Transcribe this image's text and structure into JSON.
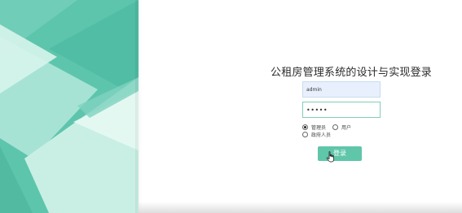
{
  "login": {
    "title": "公租房管理系统的设计与实现登录",
    "username_value": "admin",
    "password_value": "•••••",
    "roles": [
      {
        "label": "管理员",
        "checked": true
      },
      {
        "label": "用户",
        "checked": false
      },
      {
        "label": "政府人员",
        "checked": false
      }
    ],
    "submit_label": "登录"
  },
  "theme": {
    "accent": "#5ec5ad",
    "button": "#5fc6a9",
    "input_border": "#7fcfb9",
    "autofill_bg": "#e8f0fe"
  },
  "icons": {
    "cursor": "hand-pointer-icon"
  }
}
